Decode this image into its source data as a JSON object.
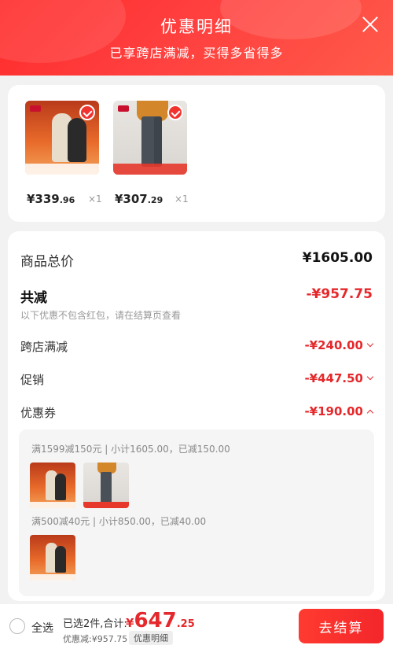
{
  "header": {
    "title": "优惠明细",
    "subtitle": "已享跨店满减，买得多省得多"
  },
  "products": [
    {
      "price_int": "¥339",
      "price_dec": ".96",
      "qty": "×1"
    },
    {
      "price_int": "¥307",
      "price_dec": ".29",
      "qty": "×1"
    }
  ],
  "summary": {
    "total_label": "商品总价",
    "total_value": "¥1605.00",
    "discount_label": "共减",
    "discount_value": "-¥957.75",
    "note": "以下优惠不包含红包，请在结算页查看",
    "items": [
      {
        "label": "跨店满减",
        "value": "-¥240.00"
      },
      {
        "label": "促销",
        "value": "-¥447.50"
      },
      {
        "label": "优惠券",
        "value": "-¥190.00"
      }
    ]
  },
  "coupons": [
    {
      "text": "满1599减150元 | 小计1605.00，已减150.00"
    },
    {
      "text": "满500减40元 | 小计850.00，已减40.00"
    }
  ],
  "bottom": {
    "select_all": "全选",
    "selected_summary": "已选2件,合计:",
    "total_sym": "¥",
    "total_int": "647",
    "total_dec": ".25",
    "saved": "优惠减:¥957.75",
    "detail_button": "优惠明细",
    "checkout_button": "去结算"
  },
  "colors": {
    "accent": "#e5282b",
    "header": "#ff3d3d"
  }
}
